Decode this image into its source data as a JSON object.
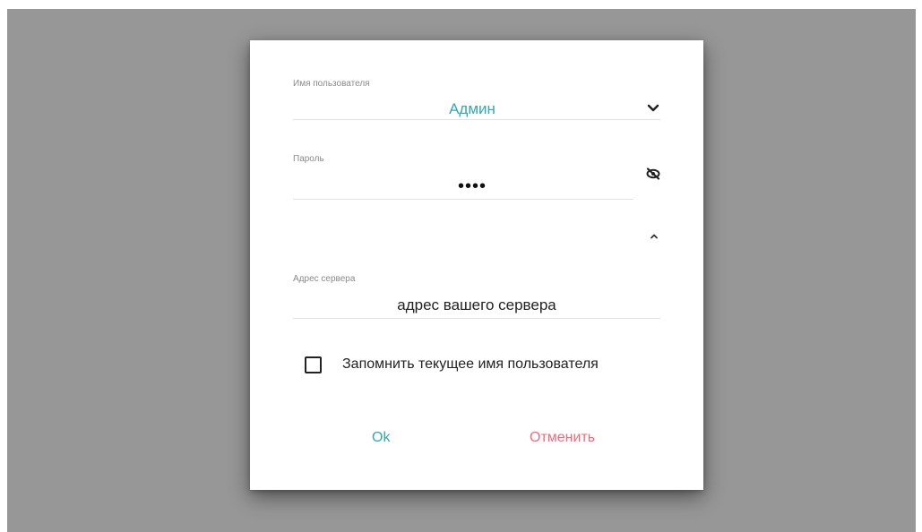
{
  "dialog": {
    "username": {
      "label": "Имя пользователя",
      "value": "Админ"
    },
    "password": {
      "label": "Пароль",
      "value": "••••"
    },
    "server": {
      "label": "Адрес сервера",
      "value": "адрес вашего сервера"
    },
    "remember": {
      "label": "Запомнить текущее имя пользователя",
      "checked": false
    },
    "ok_label": "Ok",
    "cancel_label": "Отменить"
  },
  "colors": {
    "accent": "#35a7b3",
    "cancel": "#f06a7a",
    "backdrop": "#979797"
  },
  "icons": {
    "username_dropdown": "chevron-down-icon",
    "password_visibility": "eye-off-icon",
    "collapse": "chevron-up-icon"
  }
}
